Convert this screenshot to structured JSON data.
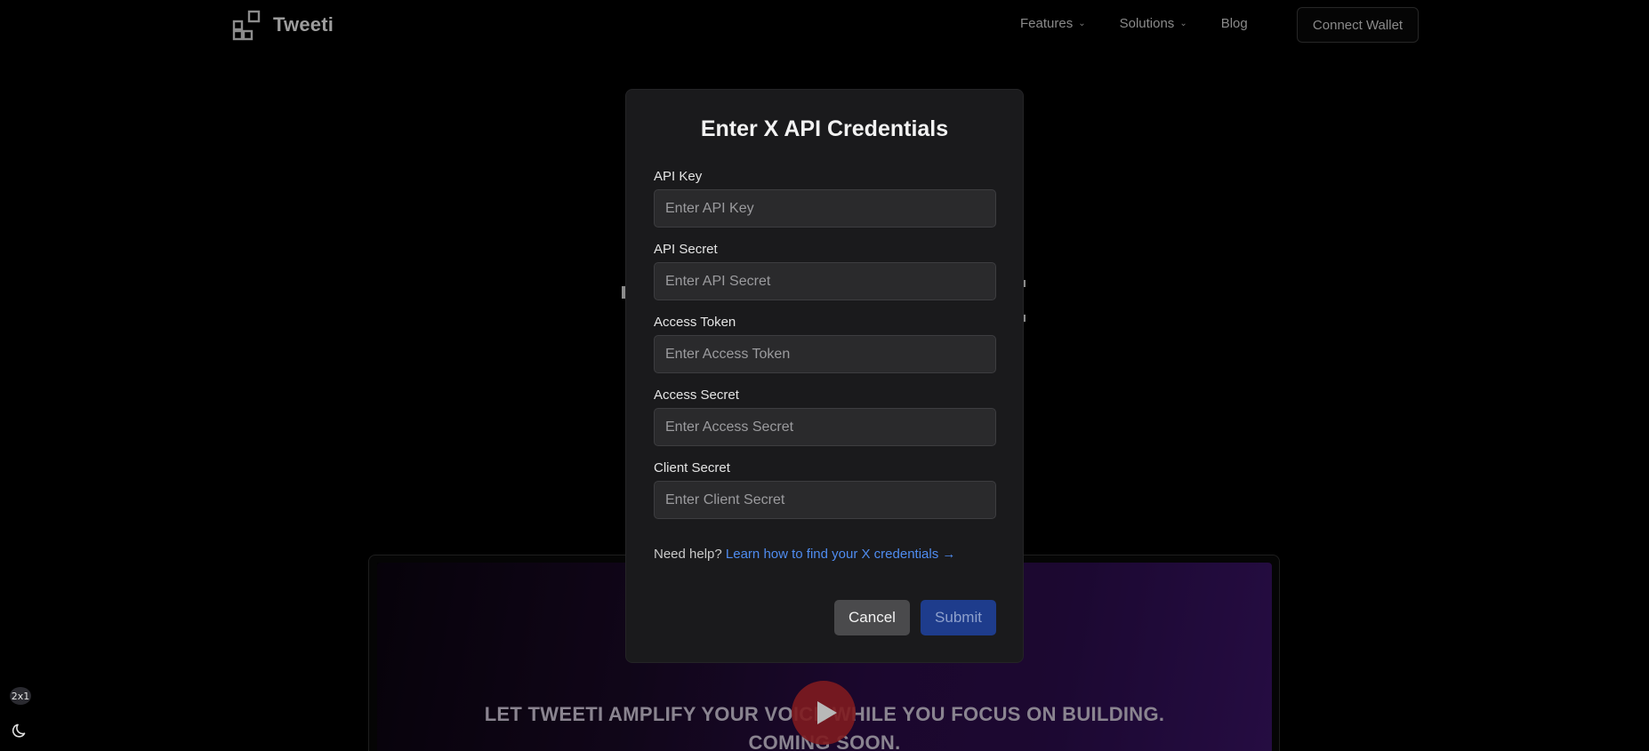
{
  "nav": {
    "brand": "Tweeti",
    "links": [
      {
        "label": "Features",
        "dropdown": true
      },
      {
        "label": "Solutions",
        "dropdown": true
      },
      {
        "label": "Blog",
        "dropdown": false
      }
    ],
    "connect_label": "Connect Wallet"
  },
  "video": {
    "caption_line1": "LET TWEETI AMPLIFY YOUR VOICE WHILE YOU FOCUS ON BUILDING.",
    "caption_line2": "COMING SOON.",
    "play_icon": "play-icon"
  },
  "modal": {
    "title": "Enter X API Credentials",
    "fields": [
      {
        "label": "API Key",
        "placeholder": "Enter API Key"
      },
      {
        "label": "API Secret",
        "placeholder": "Enter API Secret"
      },
      {
        "label": "Access Token",
        "placeholder": "Enter Access Token"
      },
      {
        "label": "Access Secret",
        "placeholder": "Enter Access Secret"
      },
      {
        "label": "Client Secret",
        "placeholder": "Enter Client Secret"
      }
    ],
    "help_prefix": "Need help?",
    "help_link": "Learn how to find your X credentials →",
    "cancel_label": "Cancel",
    "submit_label": "Submit"
  },
  "widgets": {
    "zoom_label": "2x1",
    "theme_icon": "moon-icon"
  },
  "colors": {
    "background": "#000000",
    "modal_bg": "#1a1a1c",
    "input_bg": "#2a2a2c",
    "link": "#4f8cf0",
    "submit_bg": "#1e3c8c",
    "cancel_bg": "#4a4a4c"
  }
}
